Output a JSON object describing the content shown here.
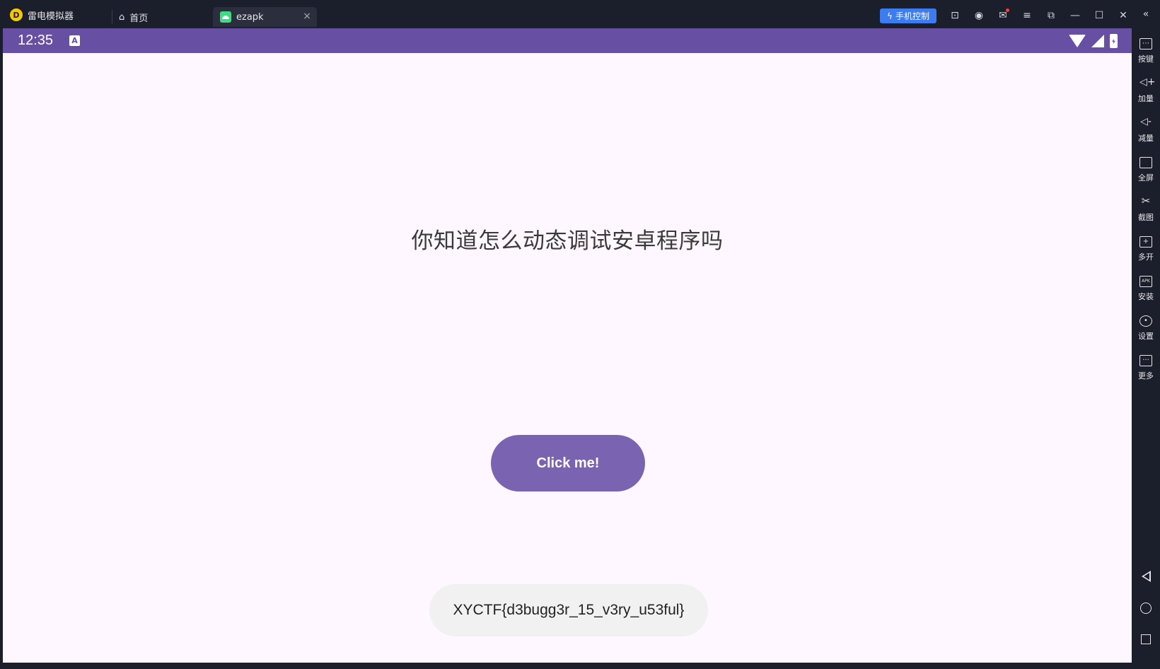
{
  "titlebar": {
    "app_name": "雷电模拟器",
    "tabs": [
      {
        "label": "首页"
      },
      {
        "label": "ezapk"
      }
    ],
    "tab_close_glyph": "×",
    "phone_control_label": "手机控制",
    "icons": [
      "lightning-icon",
      "gamepad-icon",
      "user-icon",
      "mail-icon",
      "menu-icon",
      "screen-icon",
      "minimize-icon",
      "maximize-icon",
      "close-icon",
      "collapse-panel-icon"
    ]
  },
  "statusbar": {
    "time": "12:35",
    "badge": "A"
  },
  "app": {
    "question": "你知道怎么动态调试安卓程序吗",
    "button_label": "Click me!",
    "toast": "XYCTF{d3bugg3r_15_v3ry_u53ful}",
    "accent_color": "#6750a4",
    "button_color": "#7a63b0"
  },
  "sidepanel": {
    "items": [
      {
        "label": "按键",
        "icon": "keyboard-icon"
      },
      {
        "label": "加量",
        "icon": "volume-up-icon"
      },
      {
        "label": "减量",
        "icon": "volume-down-icon"
      },
      {
        "label": "全屏",
        "icon": "fullscreen-icon"
      },
      {
        "label": "截图",
        "icon": "scissors-icon"
      },
      {
        "label": "多开",
        "icon": "multi-instance-icon"
      },
      {
        "label": "安装",
        "icon": "apk-install-icon"
      },
      {
        "label": "设置",
        "icon": "settings-icon"
      },
      {
        "label": "更多",
        "icon": "more-icon"
      }
    ],
    "nav": [
      "back-icon",
      "home-icon",
      "recent-apps-icon"
    ]
  }
}
